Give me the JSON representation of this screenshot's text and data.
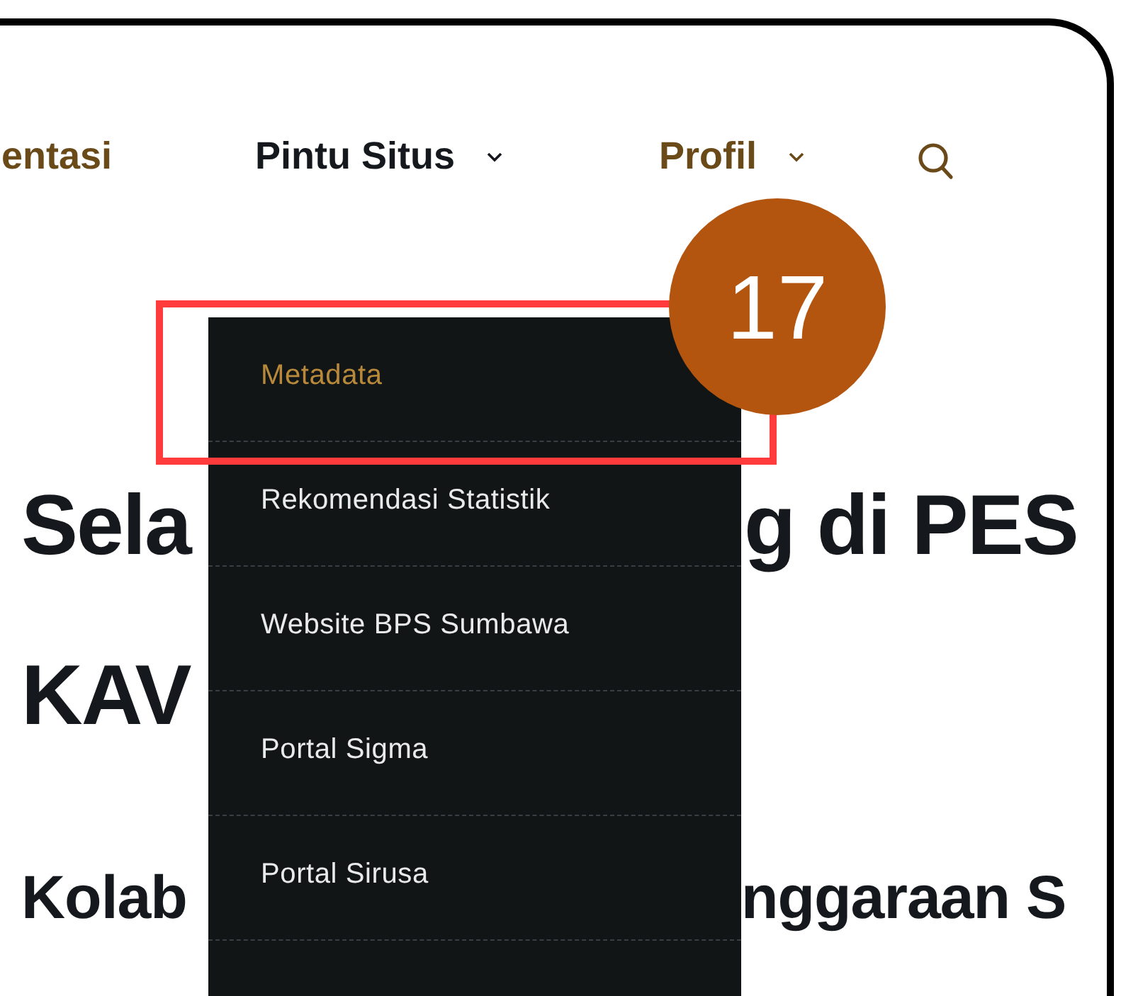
{
  "nav": {
    "items": [
      {
        "label": "entasi",
        "selected": false,
        "dropdown": false
      },
      {
        "label": "Pintu Situs",
        "selected": true,
        "dropdown": true
      },
      {
        "label": "Profil",
        "selected": false,
        "dropdown": true
      }
    ]
  },
  "heading": {
    "lines": [
      {
        "left": "Sela",
        "right": "g di PES"
      },
      {
        "left": "KAV"
      }
    ]
  },
  "subheading": {
    "left": "Kolab",
    "right": "nggaraan S"
  },
  "dropdown_menu": {
    "items": [
      {
        "label": "Metadata",
        "selected": true
      },
      {
        "label": "Rekomendasi Statistik",
        "selected": false
      },
      {
        "label": "Website BPS Sumbawa",
        "selected": false
      },
      {
        "label": "Portal Sigma",
        "selected": false
      },
      {
        "label": "Portal Sirusa",
        "selected": false
      }
    ]
  },
  "annotation": {
    "step": "17"
  }
}
